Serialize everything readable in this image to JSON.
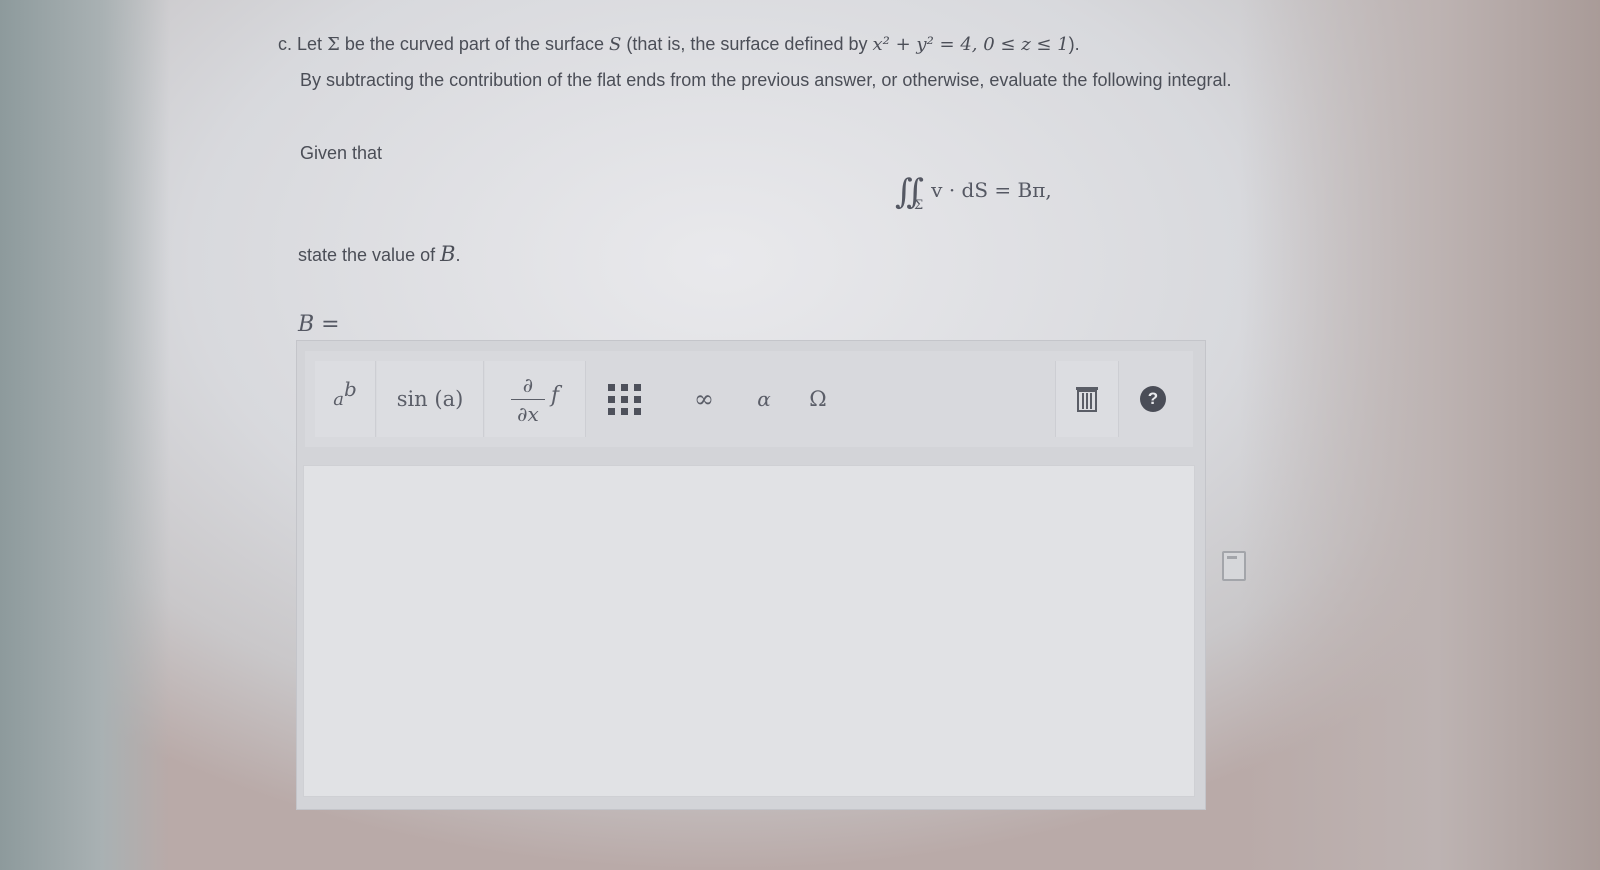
{
  "question": {
    "part": "c.",
    "line1_a": "Let",
    "sigma": "Σ",
    "line1_b": "be the curved part of the surface",
    "surface": "S",
    "line1_c": "(that is, the surface defined by",
    "equation": "x² + y² = 4, 0 ≤ z ≤ 1",
    "line1_d": ").",
    "line2": "By subtracting the contribution of the flat ends from the previous answer, or otherwise, evaluate the following integral."
  },
  "given_label": "Given that",
  "integral": {
    "sign": "∬",
    "subscript": "Σ",
    "expr": "v · dS = Bπ,"
  },
  "state_label": "state the value of",
  "state_var": "B",
  "state_end": ".",
  "answer_label": "B =",
  "toolbar": {
    "power_base": "a",
    "power_exp": "b",
    "sin_label": "sin (a)",
    "deriv_num": "∂",
    "deriv_den": "∂x",
    "deriv_f": "f",
    "infinity": "∞",
    "alpha": "α",
    "omega": "Ω"
  },
  "answer": {
    "value": ""
  },
  "icons": {
    "matrix": "matrix-icon",
    "trash": "trash-icon",
    "help": "help-icon",
    "file": "file-icon"
  }
}
